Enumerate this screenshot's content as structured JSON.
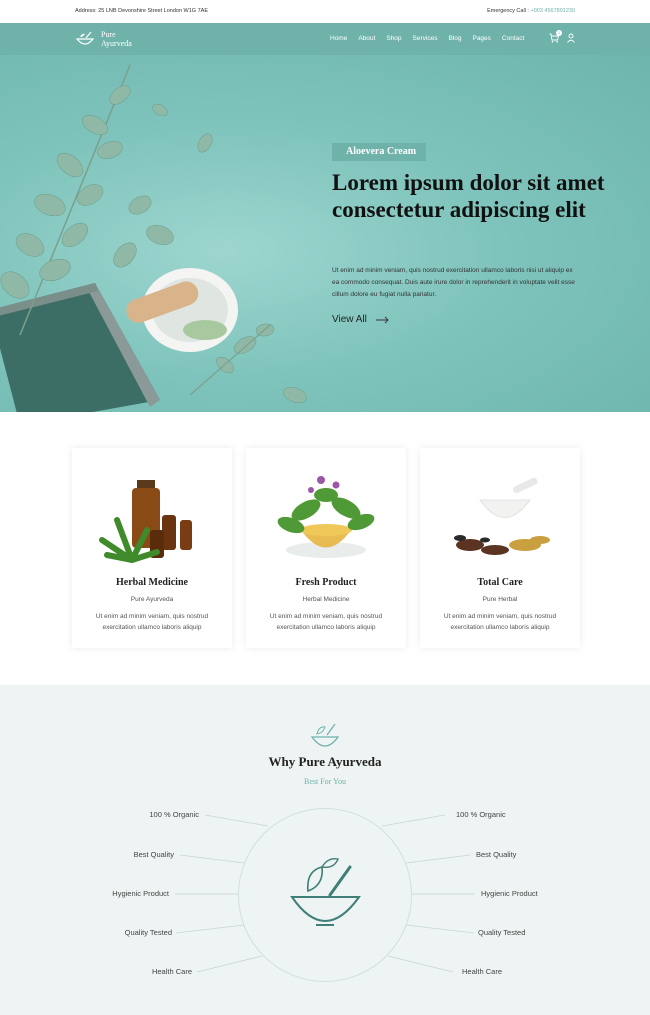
{
  "topbar": {
    "address": "Address: 25 LNB Devonshire Street London W1G 7AE",
    "emergency_label": "Emergency Call : ",
    "emergency_phone": "+003 4567891230"
  },
  "header": {
    "logo_line1": "Pure",
    "logo_line2": "Ayurveda",
    "menu": [
      "Home",
      "About",
      "Shop",
      "Services",
      "Blog",
      "Pages",
      "Contact"
    ],
    "cart_count": "1",
    "cart_icon": "cart-icon",
    "user_icon": "user-icon"
  },
  "hero": {
    "tag": "Aloevera Cream",
    "title": "Lorem ipsum dolor sit amet consectetur adipiscing elit",
    "description": "Ut enim ad minim veniam, quis nostrud exercitation ullamco laboris nisi ut aliquip ex ea commodo consequat. Duis aute irure dolor in reprehenderit in voluptate velit esse cillum dolore eu fugiat nulla pariatur.",
    "cta": "View All"
  },
  "cards": [
    {
      "title": "Herbal Medicine",
      "subtitle": "Pure Ayurveda",
      "description": "Ut enim ad minim veniam, quis nostrud exercitation ullamco laboris aliquip"
    },
    {
      "title": "Fresh Product",
      "subtitle": "Herbal Medicine",
      "description": "Ut enim ad minim veniam, quis nostrud exercitation ullamco laboris aliquip"
    },
    {
      "title": "Total Care",
      "subtitle": "Pure Herbal",
      "description": "Ut enim ad minim veniam, quis nostrud exercitation ullamco laboris aliquip"
    }
  ],
  "why": {
    "title": "Why Pure Ayurveda",
    "subtitle": "Best For You",
    "left_features": [
      "100 % Organic",
      "Best Quality",
      "Hygienic Product",
      "Quality Tested",
      "Health Care"
    ],
    "right_features": [
      "100 % Organic",
      "Best Quality",
      "Hygienic Product",
      "Quality Tested",
      "Health Care"
    ]
  },
  "colors": {
    "accent": "#6fb2aa",
    "hero_bg": "#7fc4bc",
    "section_bg": "#eef4f3"
  }
}
